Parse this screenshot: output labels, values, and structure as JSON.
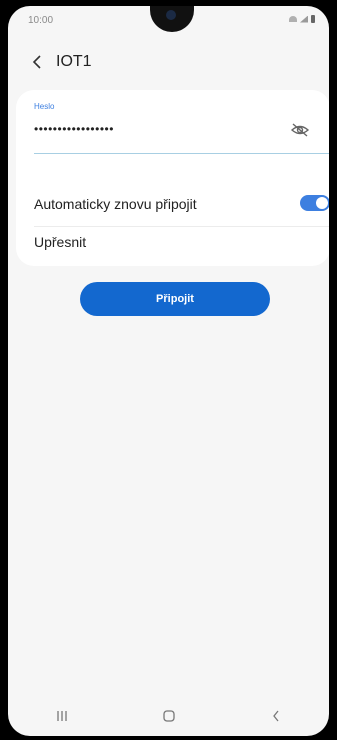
{
  "status_bar": {
    "time": "10:00"
  },
  "app_bar": {
    "title": "IOT1"
  },
  "password_field": {
    "label": "Heslo",
    "value": "•••••••••••••••••"
  },
  "settings": {
    "auto_reconnect_label": "Automaticky znovu připojit",
    "auto_reconnect_on": true,
    "advanced_label": "Upřesnit"
  },
  "connect_button_label": "Připojit",
  "colors": {
    "accent": "#1368cf",
    "toggle": "#3d7fe0"
  },
  "nav_bar": {
    "icons": [
      "recent-apps-icon",
      "home-icon",
      "back-icon"
    ]
  }
}
